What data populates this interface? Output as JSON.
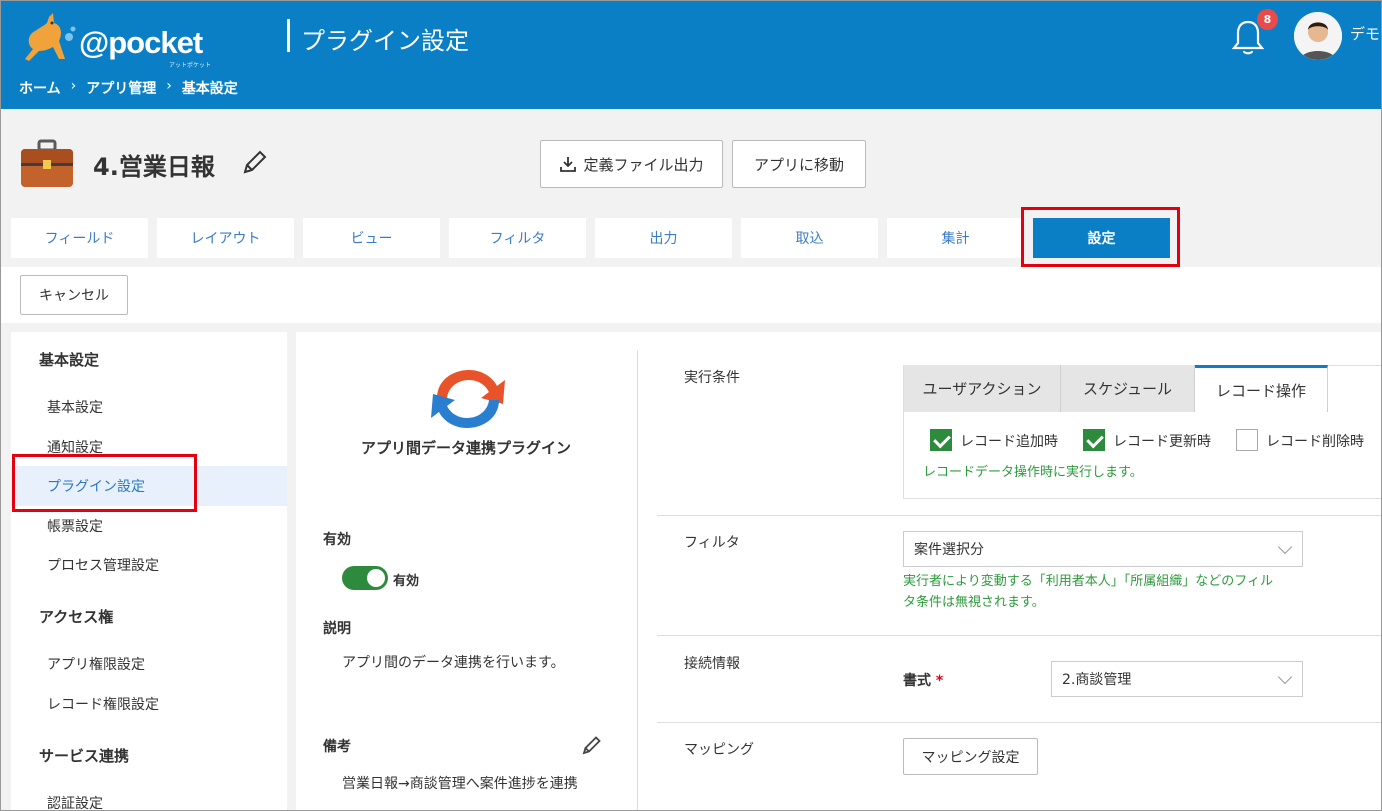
{
  "header": {
    "logo_text": "@pocket",
    "logo_sub": "アットポケット",
    "page_title": "プラグイン設定",
    "breadcrumb": [
      "ホーム",
      "アプリ管理",
      "基本設定"
    ],
    "breadcrumb_sep": "›",
    "notification_count": "8",
    "user_name": "デモ"
  },
  "app": {
    "title": "4.営業日報",
    "export_button": "定義ファイル出力",
    "goto_button": "アプリに移動"
  },
  "tabs": [
    "フィールド",
    "レイアウト",
    "ビュー",
    "フィルタ",
    "出力",
    "取込",
    "集計",
    "設定"
  ],
  "active_tab": "設定",
  "cancel_button": "キャンセル",
  "sidebar": {
    "sections": [
      {
        "title": "基本設定",
        "items": [
          "基本設定",
          "通知設定",
          "プラグイン設定",
          "帳票設定",
          "プロセス管理設定"
        ]
      },
      {
        "title": "アクセス権",
        "items": [
          "アプリ権限設定",
          "レコード権限設定"
        ]
      },
      {
        "title": "サービス連携",
        "items": [
          "認証設定"
        ]
      }
    ],
    "active_item": "プラグイン設定"
  },
  "plugin": {
    "name": "アプリ間データ連携プラグイン",
    "enabled_label": "有効",
    "enabled_state": "有効",
    "enabled": true,
    "description_label": "説明",
    "description": "アプリ間のデータ連携を行います。",
    "notes_label": "備考",
    "notes": "営業日報→商談管理へ案件進捗を連携"
  },
  "settings": {
    "exec_label": "実行条件",
    "exec_tabs": [
      "ユーザアクション",
      "スケジュール",
      "レコード操作"
    ],
    "exec_active_tab": "レコード操作",
    "checkboxes": [
      {
        "label": "レコード追加時",
        "checked": true
      },
      {
        "label": "レコード更新時",
        "checked": true
      },
      {
        "label": "レコード削除時",
        "checked": false
      }
    ],
    "exec_note": "レコードデータ操作時に実行します。",
    "filter_label": "フィルタ",
    "filter_value": "案件選択分",
    "filter_note": "実行者により変動する「利用者本人」「所属組織」などのフィルタ条件は無視されます。",
    "filter_note_line1": "実行者により変動する「利用者本人」「所属組織」などのフィル",
    "filter_note_line2": "タ条件は無視されます。",
    "connection_label": "接続情報",
    "format_label": "書式",
    "format_required": "*",
    "format_value": "2.商談管理",
    "mapping_label": "マッピング",
    "mapping_button": "マッピング設定"
  },
  "colors": {
    "header_bg": "#0a7fc6",
    "accent_green": "#2e8b3e",
    "highlight_red": "#e3000f",
    "tab_text": "#3b7dc4"
  }
}
